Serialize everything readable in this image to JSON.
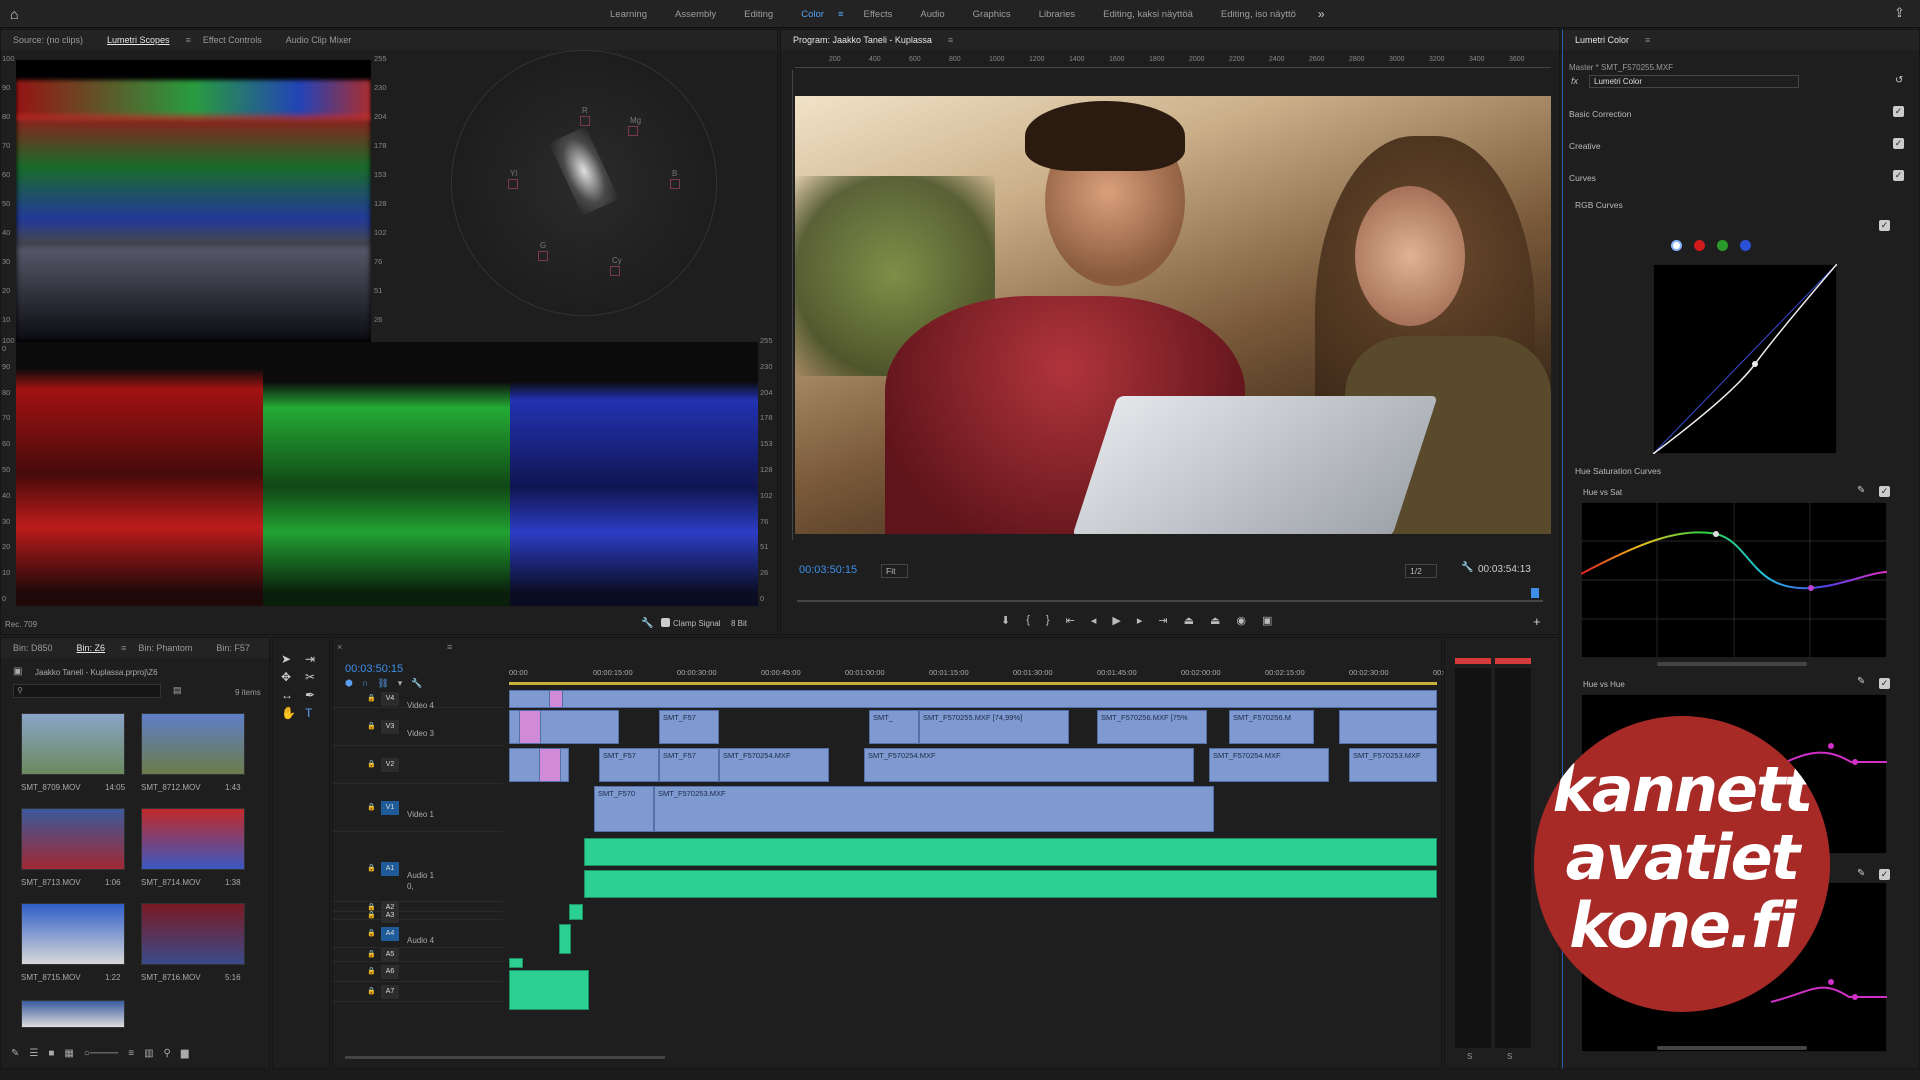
{
  "workspaces": [
    {
      "label": "Learning",
      "active": false
    },
    {
      "label": "Assembly",
      "active": false
    },
    {
      "label": "Editing",
      "active": false
    },
    {
      "label": "Color",
      "active": true
    },
    {
      "label": "Effects",
      "active": false
    },
    {
      "label": "Audio",
      "active": false
    },
    {
      "label": "Graphics",
      "active": false
    },
    {
      "label": "Libraries",
      "active": false
    },
    {
      "label": "Editing, kaksi näyttöä",
      "active": false
    },
    {
      "label": "Editing, iso näyttö",
      "active": false
    }
  ],
  "scopes": {
    "tabs": [
      "Source: (no clips)",
      "Lumetri Scopes",
      "Effect Controls",
      "Audio Clip Mixer"
    ],
    "active_tab": "Lumetri Scopes",
    "ire_scale": [
      "100",
      "90",
      "80",
      "70",
      "60",
      "50",
      "40",
      "30",
      "20",
      "10",
      "0"
    ],
    "rgb_scale": [
      "255",
      "230",
      "204",
      "178",
      "153",
      "128",
      "102",
      "76",
      "51",
      "26",
      "0"
    ],
    "vectorscope_labels": [
      "R",
      "Mg",
      "B",
      "Cy",
      "G",
      "Yl"
    ],
    "footer_standard": "Rec. 709",
    "clamp_signal": "Clamp Signal",
    "bit_depth": "8 Bit"
  },
  "program": {
    "title": "Program: Jaakko Taneli - Kuplassa",
    "ruler_ticks": [
      "200",
      "400",
      "600",
      "800",
      "1000",
      "1200",
      "1400",
      "1600",
      "1800",
      "2000",
      "2200",
      "2400",
      "2600",
      "2800",
      "3000",
      "3200",
      "3400",
      "3600"
    ],
    "timecode": "00:03:50:15",
    "fit": "Fit",
    "resolution": "1/2",
    "duration": "00:03:54:13"
  },
  "lumetri": {
    "title": "Lumetri Color",
    "master": "Master * SMT_F570255.MXF",
    "effect": "Lumetri Color",
    "sections": [
      "Basic Correction",
      "Creative",
      "Curves"
    ],
    "rgb_curves": "RGB Curves",
    "hue_sat_curves": "Hue Saturation Curves",
    "hue_vs_sat": "Hue vs Sat",
    "hue_vs_hue": "Hue vs Hue",
    "curve_channels": [
      "#ffffff",
      "#d11a1a",
      "#2a9a2a",
      "#2b4fd6"
    ]
  },
  "project": {
    "tabs": [
      "Bin: D850",
      "Bin: Z6",
      "Bin: Phantom",
      "Bin: F57"
    ],
    "active_tab": "Bin: Z6",
    "path": "Jaakko Taneli - Kuplassa.prproj\\Z6",
    "count": "9 items",
    "items": [
      {
        "name": "SMT_8709.MOV",
        "dur": "14:05"
      },
      {
        "name": "SMT_8712.MOV",
        "dur": "1:43"
      },
      {
        "name": "SMT_8713.MOV",
        "dur": "1:06"
      },
      {
        "name": "SMT_8714.MOV",
        "dur": "1:38"
      },
      {
        "name": "SMT_8715.MOV",
        "dur": "1:22"
      },
      {
        "name": "SMT_8716.MOV",
        "dur": "5:16"
      }
    ]
  },
  "timeline": {
    "timecode": "00:03:50:15",
    "ruler": [
      "00:00",
      "00:00:15:00",
      "00:00:30:00",
      "00:00:45:00",
      "00:01:00:00",
      "00:01:15:00",
      "00:01:30:00",
      "00:01:45:00",
      "00:02:00:00",
      "00:02:15:00",
      "00:02:30:00",
      "00:0"
    ],
    "video_tracks": [
      {
        "id": "V4",
        "name": "Video 4"
      },
      {
        "id": "V3",
        "name": "Video 3"
      },
      {
        "id": "V2",
        "name": ""
      },
      {
        "id": "V1",
        "name": "Video 1"
      }
    ],
    "audio_tracks": [
      {
        "id": "A1",
        "name": "Audio 1",
        "vol": "0,"
      },
      {
        "id": "A2",
        "name": ""
      },
      {
        "id": "A3",
        "name": ""
      },
      {
        "id": "A4",
        "name": "Audio 4"
      },
      {
        "id": "A5",
        "name": ""
      },
      {
        "id": "A6",
        "name": ""
      },
      {
        "id": "A7",
        "name": ""
      }
    ],
    "clips_v3": [
      "SMT_F57",
      "SMT_",
      "SMT_F570255.MXF [74,99%]",
      "SMT_F570256.MXF [75%",
      "SMT_F570256.M"
    ],
    "clips_v2": [
      "SMT_F57",
      "SMT_F57",
      "SMT_F570254.MXF",
      "SMT_F570254.MXF",
      "SMT_F570254.MXF",
      "SMT_F570253.MXF"
    ],
    "clips_v1": [
      "SMT_F570",
      "SMT_F570253.MXF"
    ],
    "meter_labels": [
      "S",
      "S"
    ]
  },
  "watermark": {
    "lines": [
      "kannett",
      "avatiet",
      "kone.fi"
    ]
  }
}
